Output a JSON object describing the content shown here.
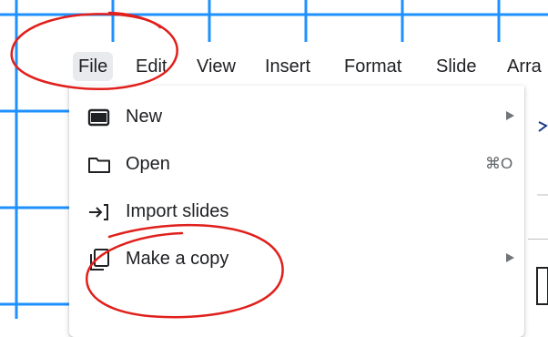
{
  "menubar": {
    "items": [
      {
        "label": "File"
      },
      {
        "label": "Edit"
      },
      {
        "label": "View"
      },
      {
        "label": "Insert"
      },
      {
        "label": "Format"
      },
      {
        "label": "Slide"
      },
      {
        "label": "Arra"
      }
    ]
  },
  "file_menu": {
    "items": [
      {
        "label": "New",
        "icon": "slides-new-icon",
        "submenu": true
      },
      {
        "label": "Open",
        "icon": "folder-icon",
        "shortcut": "⌘O"
      },
      {
        "label": "Import slides",
        "icon": "import-arrow-icon"
      },
      {
        "label": "Make a copy",
        "icon": "copy-icon",
        "submenu": true
      }
    ]
  },
  "colors": {
    "grid_line": "#1e90ff",
    "annotation": "#e0201c",
    "active_menu_bg": "#e8eaed",
    "text": "#202124"
  }
}
